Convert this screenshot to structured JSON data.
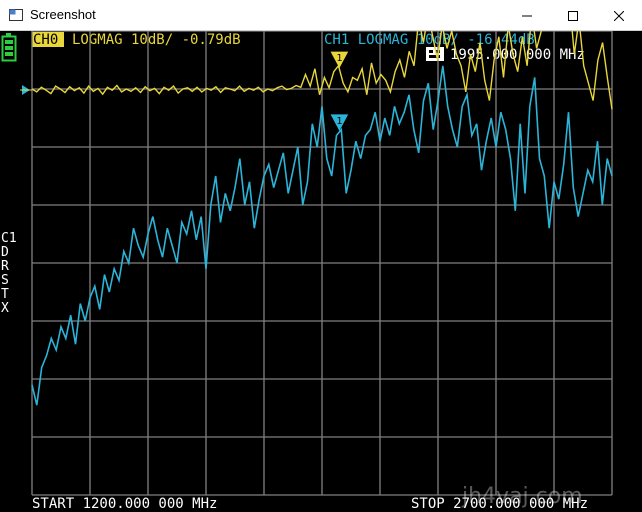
{
  "window": {
    "title": "Screenshot"
  },
  "header": {
    "ch0_badge": "CH0",
    "ch0_label": "LOGMAG 10dB/ -0.79dB",
    "ch1_label": "CH1 LOGMAG 10dB/ -16.44dB",
    "marker_readout": "1995.000 000 MHz"
  },
  "side_menu": {
    "items": [
      "C1",
      "D",
      "R",
      "S",
      "T",
      "X"
    ]
  },
  "footer": {
    "start": "START 1200.000 000 MHz",
    "stop": "STOP 2700.000 000 MHz",
    "watermark": "jh4vaj.com"
  },
  "colors": {
    "ch0": "#e8d63a",
    "ch1": "#2cb4d8",
    "grid": "#808080",
    "battery": "#2ecc40"
  },
  "chart_data": {
    "type": "line",
    "x_range_mhz": [
      1200,
      2700
    ],
    "grid": true,
    "divisions": {
      "x": 10,
      "y": 7
    },
    "marker_mhz": 1995,
    "series": [
      {
        "name": "CH0",
        "values": [
          0.0,
          -0.05,
          0.03,
          -0.02,
          -0.08,
          0.05,
          0.0,
          -0.06,
          0.04,
          -0.03,
          0.02,
          -0.07,
          0.05,
          -0.04,
          0.01,
          -0.09,
          0.03,
          -0.02,
          0.06,
          -0.05,
          0.0,
          -0.04,
          0.02,
          -0.06,
          0.04,
          -0.03,
          0.01,
          -0.08,
          0.03,
          -0.02,
          0.05,
          -0.07,
          0.0,
          0.02,
          -0.04,
          0.03,
          -0.05,
          0.01,
          -0.02,
          0.04,
          -0.06,
          0.02,
          0.0,
          -0.03,
          0.05,
          -0.04,
          0.01,
          -0.02,
          0.03,
          -0.05,
          0.0,
          -0.03,
          0.02,
          0.05,
          -0.01,
          0.01,
          0.06,
          0.03,
          0.25,
          0.05,
          0.35,
          -0.1,
          0.2,
          0.02,
          0.3,
          0.4,
          0.1,
          -0.05,
          0.2,
          0.15,
          0.35,
          -0.1,
          0.45,
          0.1,
          0.25,
          0.15,
          -0.05,
          0.3,
          0.5,
          0.2,
          0.65,
          0.4,
          1.2,
          0.8,
          1.3,
          0.9,
          0.5,
          1.1,
          0.7,
          1.0,
          0.6,
          0.4,
          -0.05,
          0.6,
          0.3,
          0.8,
          0.15,
          -0.2,
          0.5,
          0.9,
          0.2,
          1.1,
          0.6,
          0.3,
          0.9,
          0.4,
          1.3,
          0.7,
          1.0,
          1.2,
          1.6,
          2.8,
          1.8,
          2.2,
          1.5,
          0.6,
          1.2,
          0.4,
          0.1,
          -0.2,
          0.5,
          0.8,
          0.2,
          -0.35
        ]
      },
      {
        "name": "CH1",
        "values": [
          -5.1,
          -5.45,
          -4.8,
          -4.6,
          -4.3,
          -4.5,
          -4.1,
          -4.3,
          -3.9,
          -4.4,
          -3.7,
          -4.0,
          -3.6,
          -3.4,
          -3.8,
          -3.2,
          -3.5,
          -3.1,
          -3.3,
          -2.8,
          -3.0,
          -2.4,
          -2.7,
          -2.9,
          -2.5,
          -2.2,
          -2.6,
          -2.9,
          -2.4,
          -2.7,
          -3.0,
          -2.3,
          -2.5,
          -2.1,
          -2.6,
          -2.2,
          -3.1,
          -2.0,
          -1.5,
          -2.3,
          -1.8,
          -2.1,
          -1.7,
          -1.2,
          -2.0,
          -1.6,
          -2.4,
          -1.9,
          -1.5,
          -1.3,
          -1.7,
          -1.4,
          -1.1,
          -1.8,
          -1.4,
          -1.0,
          -2.0,
          -1.6,
          -0.6,
          -1.0,
          -0.3,
          -1.2,
          -1.5,
          -0.8,
          -0.7,
          -1.8,
          -1.4,
          -0.9,
          -1.2,
          -0.8,
          -0.7,
          -0.4,
          -0.9,
          -0.5,
          -0.8,
          -0.3,
          -0.6,
          -0.4,
          -0.1,
          -0.7,
          -1.1,
          -0.2,
          0.1,
          -0.7,
          -0.2,
          0.4,
          -0.3,
          -0.7,
          -1.0,
          -0.3,
          -0.1,
          -0.8,
          -0.6,
          -1.4,
          -0.9,
          -0.5,
          -1.0,
          -0.4,
          -0.7,
          -1.2,
          -2.1,
          -0.6,
          -1.8,
          -0.3,
          0.2,
          -1.2,
          -1.5,
          -2.4,
          -1.6,
          -1.9,
          -1.3,
          -0.4,
          -1.7,
          -2.2,
          -1.8,
          -1.4,
          -1.6,
          -0.9,
          -2.0,
          -1.2,
          -1.5
        ]
      }
    ]
  }
}
